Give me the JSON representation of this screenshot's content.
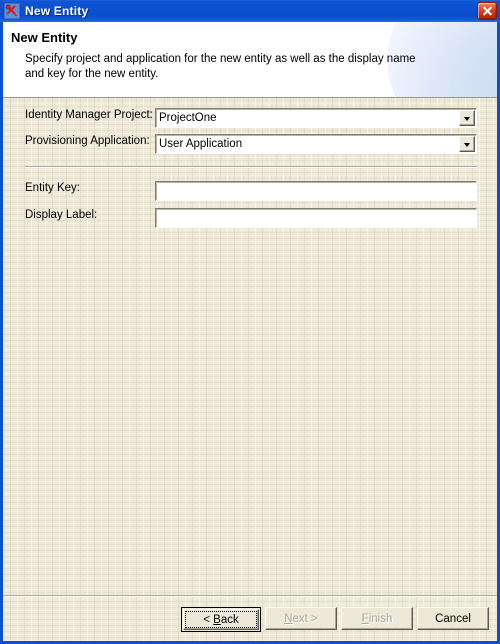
{
  "window": {
    "title": "New Entity",
    "icon": "novell-entity-icon",
    "close_label": "Close",
    "titlebar_color": "#0a50d0",
    "client_bg": "#ece9d8"
  },
  "banner": {
    "title": "New Entity",
    "description": "Specify project and application for the new entity as well as the display name and key for the new entity.",
    "bg": "#ffffff"
  },
  "form": {
    "project": {
      "label": "Identity Manager Project:",
      "value": "ProjectOne",
      "arrow_icon": "chevron-down-icon"
    },
    "application": {
      "label": "Provisioning Application:",
      "value": "User Application",
      "arrow_icon": "chevron-down-icon"
    },
    "entity_key": {
      "label": "Entity Key:",
      "value": "",
      "placeholder": ""
    },
    "display_label": {
      "label": "Display Label:",
      "value": "",
      "placeholder": ""
    }
  },
  "buttons": [
    {
      "name": "back",
      "text_before": "< ",
      "mnemonic": "B",
      "text_after": "ack",
      "enabled": true,
      "default": true
    },
    {
      "name": "next",
      "text_before": "",
      "mnemonic": "N",
      "text_after": "ext >",
      "enabled": false,
      "default": false
    },
    {
      "name": "finish",
      "text_before": "",
      "mnemonic": "F",
      "text_after": "inish",
      "enabled": false,
      "default": false
    },
    {
      "name": "cancel",
      "text_before": "",
      "mnemonic": "",
      "text_after": "Cancel",
      "enabled": true,
      "default": false
    }
  ],
  "button_labels": {
    "back": "< Back",
    "next": "Next >",
    "finish": "Finish",
    "cancel": "Cancel"
  }
}
